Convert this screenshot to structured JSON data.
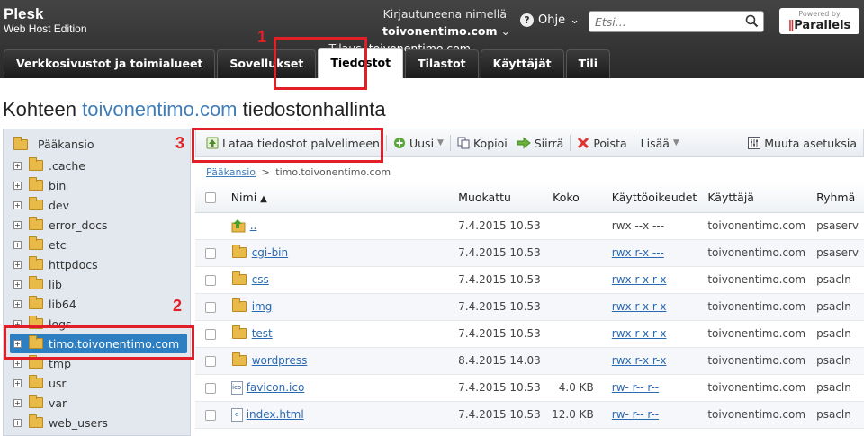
{
  "header": {
    "brand": "Plesk",
    "edition": "Web Host Edition",
    "logged_in_label": "Kirjautuneena nimellä",
    "logged_in_user": "toivonentimo.com",
    "subscription_label": "Tilaus",
    "subscription_value": "toivonentimo.com",
    "help_label": "Ohje",
    "search_placeholder": "Etsi...",
    "powered_by": "Powered by",
    "parallels": "Parallels"
  },
  "tabs": [
    "Verkkosivustot ja toimialueet",
    "Sovellukset",
    "Tiedostot",
    "Tilastot",
    "Käyttäjät",
    "Tili"
  ],
  "annotations": {
    "n1": "1",
    "n2": "2",
    "n3": "3"
  },
  "page_title": {
    "prefix": "Kohteen",
    "domain": "toivonentimo.com",
    "suffix": "tiedostonhallinta"
  },
  "tree": {
    "root": "Pääkansio",
    "items": [
      ".cache",
      "bin",
      "dev",
      "error_docs",
      "etc",
      "httpdocs",
      "lib",
      "lib64",
      "logs",
      "timo.toivonentimo.com",
      "tmp",
      "usr",
      "var",
      "web_users"
    ]
  },
  "toolbar": {
    "upload": "Lataa tiedostot palvelimeen",
    "new": "Uusi",
    "copy": "Kopioi",
    "move": "Siirrä",
    "delete": "Poista",
    "more": "Lisää",
    "settings": "Muuta asetuksia"
  },
  "breadcrumb": {
    "root": "Pääkansio",
    "sep": ">",
    "current": "timo.toivonentimo.com"
  },
  "columns": [
    "Nimi",
    "Muokattu",
    "Koko",
    "Käyttöoikeudet",
    "Käyttäjä",
    "Ryhmä"
  ],
  "rows": [
    {
      "name": "..",
      "modified": "7.4.2015 10.53",
      "size": "",
      "perm": "rwx --x ---",
      "user": "toivonentimo.com",
      "group": "psaserv"
    },
    {
      "name": "cgi-bin",
      "modified": "7.4.2015 10.53",
      "size": "",
      "perm": "rwx r-x ---",
      "user": "toivonentimo.com",
      "group": "psaserv"
    },
    {
      "name": "css",
      "modified": "7.4.2015 10.53",
      "size": "",
      "perm": "rwx r-x r-x",
      "user": "toivonentimo.com",
      "group": "psacln"
    },
    {
      "name": "img",
      "modified": "7.4.2015 10.53",
      "size": "",
      "perm": "rwx r-x r-x",
      "user": "toivonentimo.com",
      "group": "psacln"
    },
    {
      "name": "test",
      "modified": "7.4.2015 10.53",
      "size": "",
      "perm": "rwx r-x r-x",
      "user": "toivonentimo.com",
      "group": "psacln"
    },
    {
      "name": "wordpress",
      "modified": "8.4.2015 14.03",
      "size": "",
      "perm": "rwx r-x r-x",
      "user": "toivonentimo.com",
      "group": "psacln"
    },
    {
      "name": "favicon.ico",
      "modified": "7.4.2015 10.53",
      "size": "4.0 KB",
      "perm": "rw- r-- r--",
      "user": "toivonentimo.com",
      "group": "psacln"
    },
    {
      "name": "index.html",
      "modified": "7.4.2015 10.53",
      "size": "12.0 KB",
      "perm": "rw- r-- r--",
      "user": "toivonentimo.com",
      "group": "psacln"
    }
  ]
}
